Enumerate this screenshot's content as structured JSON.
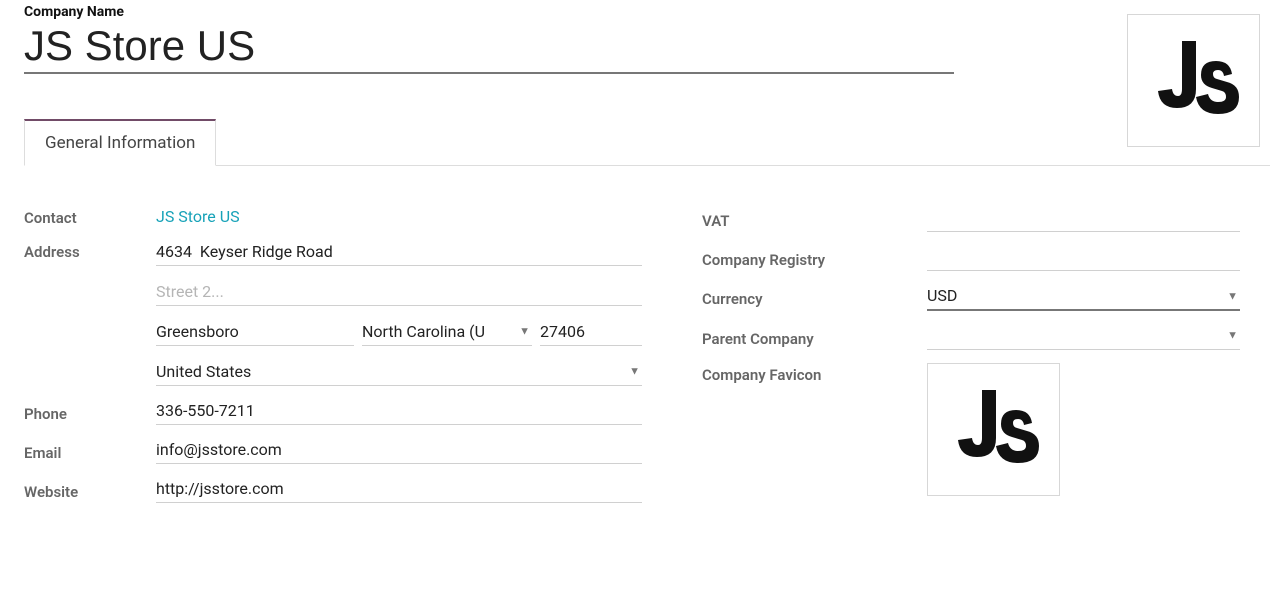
{
  "header": {
    "label": "Company Name",
    "value": "JS Store US"
  },
  "tabs": {
    "general": "General Information"
  },
  "left": {
    "contact_label": "Contact",
    "contact_value": "JS Store US",
    "address_label": "Address",
    "street": "4634  Keyser Ridge Road",
    "street2_placeholder": "Street 2...",
    "city": "Greensboro",
    "state": "North Carolina (U",
    "zip": "27406",
    "country": "United States",
    "phone_label": "Phone",
    "phone": "336-550-7211",
    "email_label": "Email",
    "email": "info@jsstore.com",
    "website_label": "Website",
    "website": "http://jsstore.com"
  },
  "right": {
    "vat_label": "VAT",
    "vat": "",
    "registry_label": "Company Registry",
    "registry": "",
    "currency_label": "Currency",
    "currency": "USD",
    "parent_label": "Parent Company",
    "parent": "",
    "favicon_label": "Company Favicon"
  }
}
